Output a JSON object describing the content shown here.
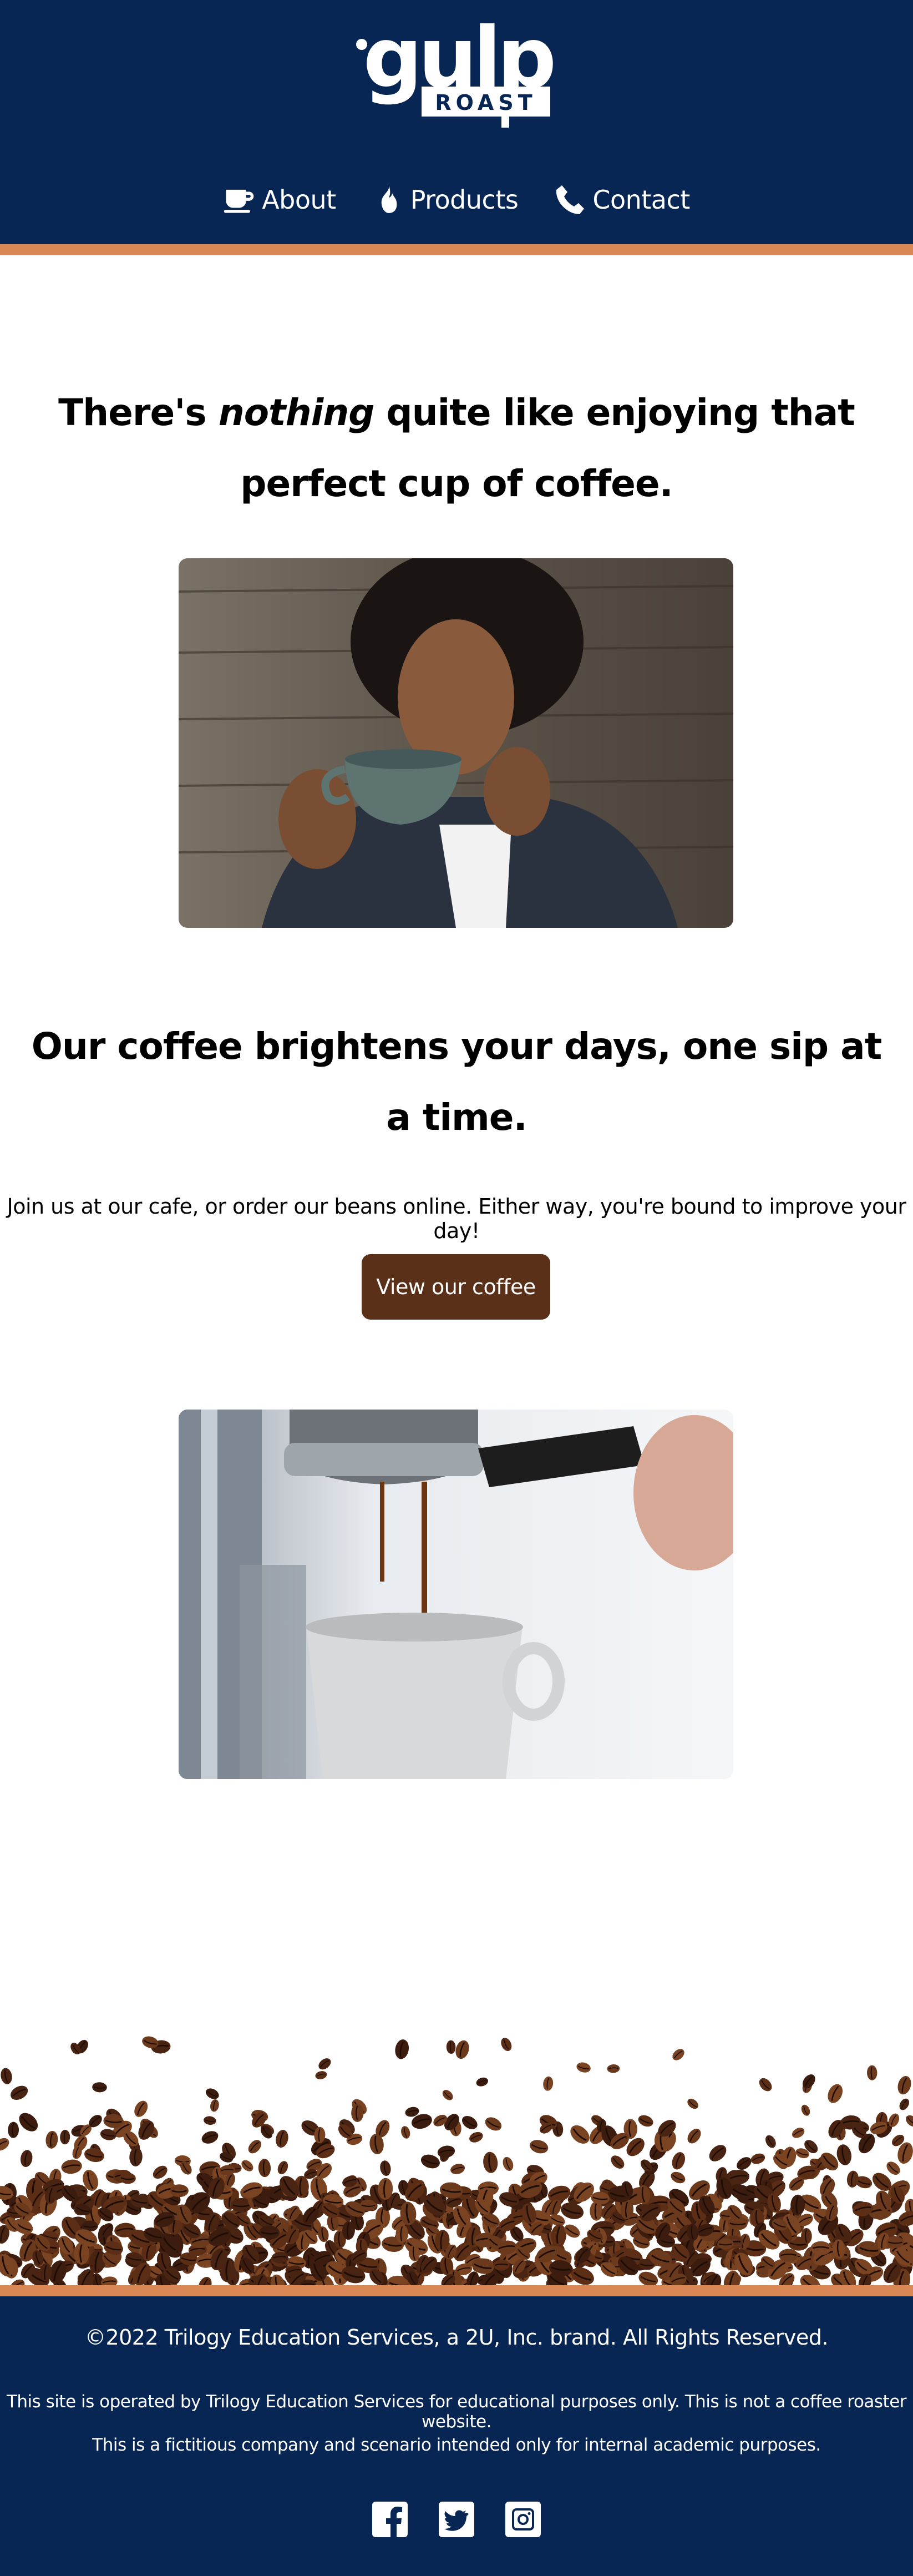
{
  "brand": {
    "logo_word": "gulp",
    "logo_sub": "ROAST"
  },
  "nav": {
    "items": [
      {
        "label": "About",
        "icon": "coffee-cup-icon"
      },
      {
        "label": "Products",
        "icon": "fire-icon"
      },
      {
        "label": "Contact",
        "icon": "phone-icon"
      }
    ]
  },
  "hero": {
    "headline_before": "There's ",
    "headline_em": "nothing",
    "headline_after": " quite like enjoying that perfect cup of coffee."
  },
  "section": {
    "headline": "Our coffee brightens your days, one sip at a time.",
    "intro": "Join us at our cafe, or order our beans online. Either way, you're bound to improve your day!",
    "button_label": "View our coffee"
  },
  "footer": {
    "copyright": "©2022 Trilogy Education Services, a 2U, Inc. brand. All Rights Reserved.",
    "disclaimer_1": "This site is operated by Trilogy Education Services for educational purposes only. This is not a coffee roaster website.",
    "disclaimer_2": "This is a fictitious company and scenario intended only for internal academic purposes.",
    "social": [
      "facebook-icon",
      "twitter-icon",
      "instagram-icon"
    ]
  },
  "colors": {
    "navy": "#072653",
    "accent_stripe": "#d98855",
    "button_brown": "#5b3018",
    "text": "#000000"
  }
}
